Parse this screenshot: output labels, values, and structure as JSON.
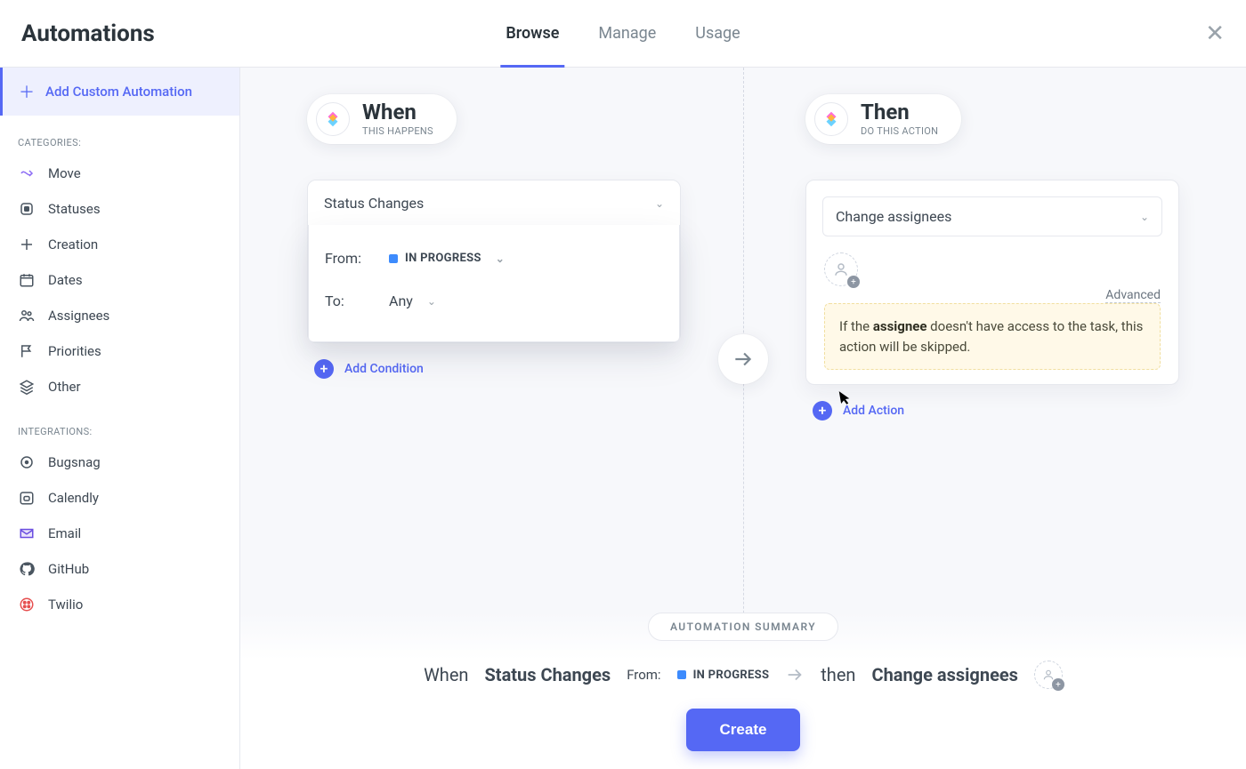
{
  "header": {
    "title": "Automations",
    "tabs": [
      "Browse",
      "Manage",
      "Usage"
    ],
    "active_tab": "Browse"
  },
  "sidebar": {
    "add_custom_label": "Add Custom Automation",
    "categories_label": "CATEGORIES:",
    "categories": [
      {
        "icon": "arrow-share",
        "label": "Move"
      },
      {
        "icon": "badge",
        "label": "Statuses"
      },
      {
        "icon": "plus-outlined",
        "label": "Creation"
      },
      {
        "icon": "calendar",
        "label": "Dates"
      },
      {
        "icon": "people",
        "label": "Assignees"
      },
      {
        "icon": "flag",
        "label": "Priorities"
      },
      {
        "icon": "stack",
        "label": "Other"
      }
    ],
    "integrations_label": "INTEGRATIONS:",
    "integrations": [
      {
        "icon": "bugsnag",
        "label": "Bugsnag"
      },
      {
        "icon": "calendly",
        "label": "Calendly"
      },
      {
        "icon": "email",
        "label": "Email"
      },
      {
        "icon": "github",
        "label": "GitHub"
      },
      {
        "icon": "twilio",
        "label": "Twilio"
      }
    ]
  },
  "when": {
    "title": "When",
    "subtitle": "THIS HAPPENS",
    "trigger_label": "Status Changes",
    "from_label": "From:",
    "from_value": "IN PROGRESS",
    "to_label": "To:",
    "to_value": "Any",
    "add_condition_label": "Add Condition"
  },
  "then": {
    "title": "Then",
    "subtitle": "DO THIS ACTION",
    "action_label": "Change assignees",
    "advanced_label": "Advanced",
    "warn_prefix": "If the ",
    "warn_bold": "assignee",
    "warn_suffix": " doesn't have access to the task, this action will be skipped.",
    "add_action_label": "Add Action"
  },
  "summary": {
    "pill": "AUTOMATION SUMMARY",
    "when_word": "When",
    "when_value": "Status Changes",
    "from_label": "From:",
    "from_value": "IN PROGRESS",
    "then_word": "then",
    "then_value": "Change assignees",
    "create_label": "Create"
  }
}
